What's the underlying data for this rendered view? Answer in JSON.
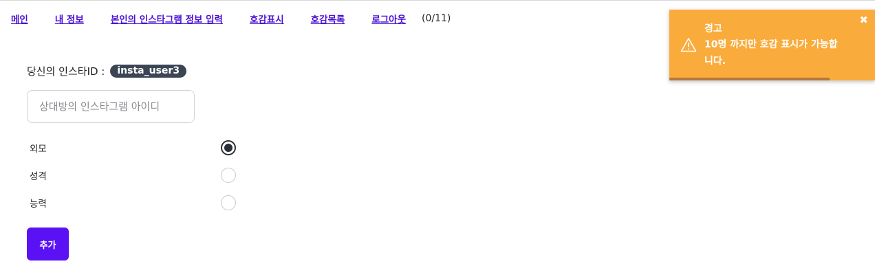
{
  "nav": {
    "items": [
      "메인",
      "내 정보",
      "본인의 인스타그램 정보 입력",
      "호감표시",
      "호감목록",
      "로그아웃"
    ],
    "count": "(0/11)"
  },
  "profile": {
    "label": "당신의 인스타ID :",
    "insta_id": "insta_user3"
  },
  "form": {
    "target_placeholder": "상대방의 인스타그램 아이디",
    "options": [
      {
        "label": "외모",
        "checked": true
      },
      {
        "label": "성격",
        "checked": false
      },
      {
        "label": "능력",
        "checked": false
      }
    ],
    "add_label": "추가"
  },
  "toast": {
    "title": "경고",
    "message": "10명 까지만 호감 표시가 가능합니다.",
    "close": "✖",
    "icon": "warning-icon",
    "progress": 0.78,
    "color": "#f9ab3b"
  }
}
